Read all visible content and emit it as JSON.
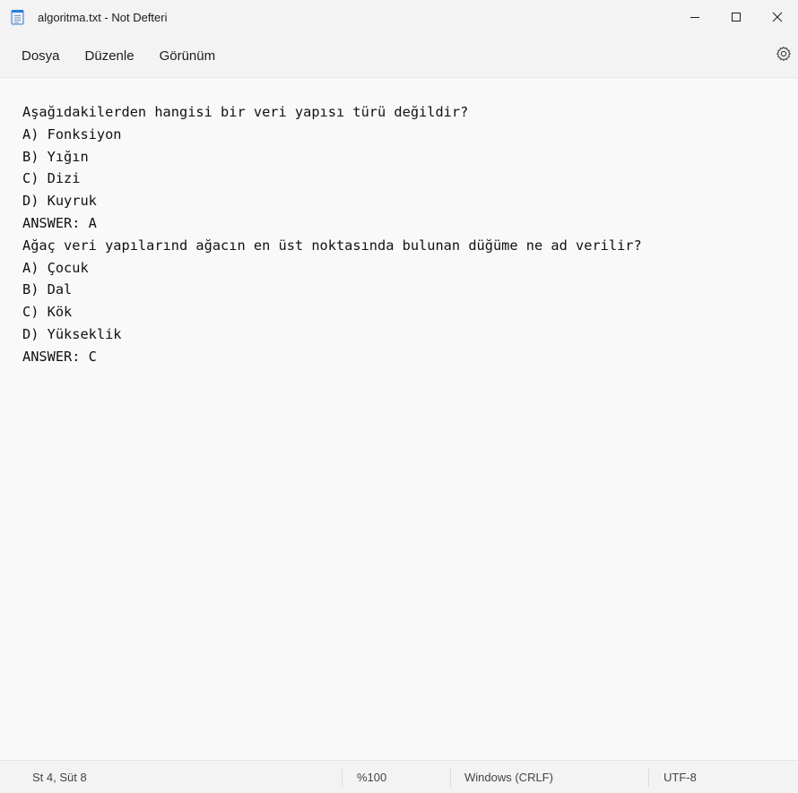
{
  "window": {
    "title": "algoritma.txt - Not Defteri"
  },
  "menu": {
    "items": [
      "Dosya",
      "Düzenle",
      "Görünüm"
    ]
  },
  "editor": {
    "lines": [
      "Aşağıdakilerden hangisi bir veri yapısı türü değildir?",
      "A) Fonksiyon",
      "B) Yığın",
      "C) Dizi",
      "D) Kuyruk",
      "ANSWER: A",
      "Ağaç veri yapılarınd ağacın en üst noktasında bulunan düğüme ne ad verilir?",
      "A) Çocuk",
      "B) Dal",
      "C) Kök",
      "D) Yükseklik",
      "ANSWER: C"
    ]
  },
  "status": {
    "position": "St 4, Süt 8",
    "zoom": "%100",
    "line_ending": "Windows (CRLF)",
    "encoding": "UTF-8"
  },
  "icons": {
    "app": "notepad-icon",
    "minimize": "minimize-icon",
    "maximize": "maximize-icon",
    "close": "close-icon",
    "settings": "gear-icon"
  },
  "colors": {
    "chrome": "#f3f3f3",
    "editor_bg": "#f9f9f9",
    "app_icon": "#2b7cd3"
  }
}
